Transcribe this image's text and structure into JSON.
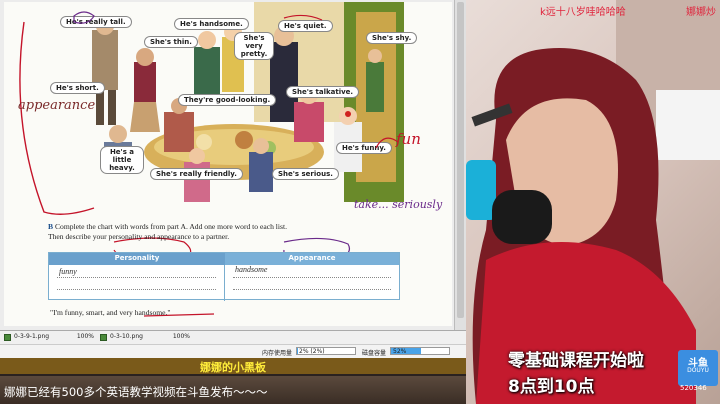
{
  "textbook": {
    "bubbles": {
      "really_tall": "He's really tall.",
      "handsome": "He's handsome.",
      "quiet": "He's quiet.",
      "thin": "She's thin.",
      "very_pretty": "She's very pretty.",
      "shy": "She's shy.",
      "short": "He's short.",
      "good_looking": "They're good-looking.",
      "talkative": "She's talkative.",
      "little_heavy": "He's a little heavy.",
      "funny": "He's funny.",
      "friendly": "She's really friendly.",
      "serious": "She's serious."
    },
    "partB": {
      "letter": "B",
      "line1": "Complete the chart with words from part A. Add one more word to each list.",
      "line2": "Then describe your personality and appearance to a partner."
    },
    "chart": {
      "col1_header": "Personality",
      "col2_header": "Appearance",
      "col1_word": "funny",
      "col2_word": "handsome"
    },
    "quote": "\"I'm funny, smart, and very handsome.\""
  },
  "annotations": {
    "appearance": "appearance",
    "fun": "fun",
    "take_seriously": "take... seriously"
  },
  "thumbnails": [
    {
      "file": "0-3-9-1.png",
      "zoom": "100%"
    },
    {
      "file": "0-3-10.png",
      "zoom": "100%"
    }
  ],
  "status": {
    "memory_label": "内存使用量",
    "memory_value": "2% (2%)",
    "memory_fraction": 0.02,
    "disk_label": "磁盘容量",
    "disk_value": "52%",
    "disk_fraction": 0.52
  },
  "caption": "娜娜的小黑板",
  "ticker": "娜娜已经有500多个英语教学视频在斗鱼发布～～～",
  "stream": {
    "top_message": "k远十八岁哇哈哈哈",
    "streamer_name": "娜娜炒",
    "promo_line1": "零基础课程开始啦",
    "promo_line2": "8点到10点",
    "logo_main": "斗鱼",
    "logo_sub": "DOUYU",
    "room_id": "520346"
  }
}
